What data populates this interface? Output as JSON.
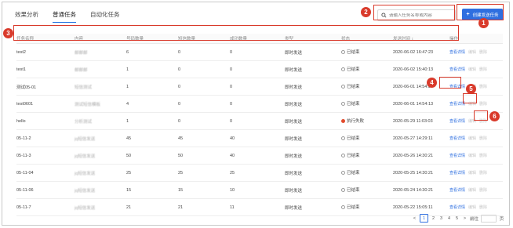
{
  "tabs": [
    {
      "label": "效果分析"
    },
    {
      "label": "普通任务"
    },
    {
      "label": "自动化任务"
    }
  ],
  "search": {
    "placeholder": "请输入任务名称或内容"
  },
  "create_button": {
    "label": "创建发送任务"
  },
  "table": {
    "headers": [
      "任务名称",
      "内容",
      "号码数量",
      "短信数量",
      "成功数量",
      "类型",
      "状态",
      "发送时间 ↕",
      "操作"
    ],
    "rows": [
      {
        "name": "test2",
        "content": "邮邮邮",
        "numbers": "6",
        "sms": "0",
        "success": "0",
        "type": "即时发送",
        "status": "已结束",
        "status_kind": "done",
        "time": "2020-06-02 16:47:23",
        "op1": "查看详情",
        "op2": "编辑",
        "op3": "删除"
      },
      {
        "name": "test1",
        "content": "邮邮邮",
        "numbers": "1",
        "sms": "0",
        "success": "0",
        "type": "即时发送",
        "status": "已结束",
        "status_kind": "done",
        "time": "2020-06-02 15:40:13",
        "op1": "查看详情",
        "op2": "编辑",
        "op3": "删除"
      },
      {
        "name": "测试05-01",
        "content": "短信测试",
        "numbers": "1",
        "sms": "0",
        "success": "0",
        "type": "即时发送",
        "status": "已结束",
        "status_kind": "done",
        "time": "2020-06-01 14:54:37",
        "op1": "查看详情",
        "op2": "编辑",
        "op3": "删除"
      },
      {
        "name": "test0601",
        "content": "测试短信模板",
        "numbers": "4",
        "sms": "0",
        "success": "0",
        "type": "即时发送",
        "status": "已结束",
        "status_kind": "done",
        "time": "2020-06-01 14:54:13",
        "op1": "查看详情",
        "op2": "编辑",
        "op3": "删除"
      },
      {
        "name": "hello",
        "content": "分析测试",
        "numbers": "1",
        "sms": "0",
        "success": "0",
        "type": "即时发送",
        "status": "执行失败",
        "status_kind": "fail",
        "time": "2020-05-29 11:03:03",
        "op1": "查看详情",
        "op2": "编辑",
        "op3": "删除"
      },
      {
        "name": "05-11-2",
        "content": "jq短信发送",
        "numbers": "45",
        "sms": "45",
        "success": "40",
        "type": "即时发送",
        "status": "已结束",
        "status_kind": "done",
        "time": "2020-05-27 14:29:11",
        "op1": "查看详情",
        "op2": "编辑",
        "op3": "删除"
      },
      {
        "name": "05-11-3",
        "content": "jq短信发送",
        "numbers": "50",
        "sms": "50",
        "success": "40",
        "type": "即时发送",
        "status": "已结束",
        "status_kind": "done",
        "time": "2020-05-26 14:30:21",
        "op1": "查看详情",
        "op2": "编辑",
        "op3": "删除"
      },
      {
        "name": "05-11-04",
        "content": "jq短信发送",
        "numbers": "25",
        "sms": "25",
        "success": "25",
        "type": "即时发送",
        "status": "已结束",
        "status_kind": "done",
        "time": "2020-05-25 14:30:21",
        "op1": "查看详情",
        "op2": "编辑",
        "op3": "删除"
      },
      {
        "name": "05-11-06",
        "content": "jq短信发送",
        "numbers": "15",
        "sms": "15",
        "success": "10",
        "type": "即时发送",
        "status": "已结束",
        "status_kind": "done",
        "time": "2020-05-24 14:30:21",
        "op1": "查看详情",
        "op2": "编辑",
        "op3": "删除"
      },
      {
        "name": "05-11-7",
        "content": "jq短信发送",
        "numbers": "21",
        "sms": "21",
        "success": "11",
        "type": "即时发送",
        "status": "已结束",
        "status_kind": "done",
        "time": "2020-05-22 15:05:11",
        "op1": "查看详情",
        "op2": "编辑",
        "op3": "删除"
      }
    ]
  },
  "pagination": {
    "prev": "<",
    "pages": [
      "1",
      "2",
      "3",
      "4",
      "5"
    ],
    "current": "1",
    "next": ">",
    "goto_label": "前往",
    "page_suffix": "页"
  },
  "annotations": [
    "1",
    "2",
    "3",
    "4",
    "5",
    "6"
  ],
  "colors": {
    "accent": "#2f6fe0",
    "annotation": "#d93a2b",
    "fail": "#e24b2c"
  }
}
